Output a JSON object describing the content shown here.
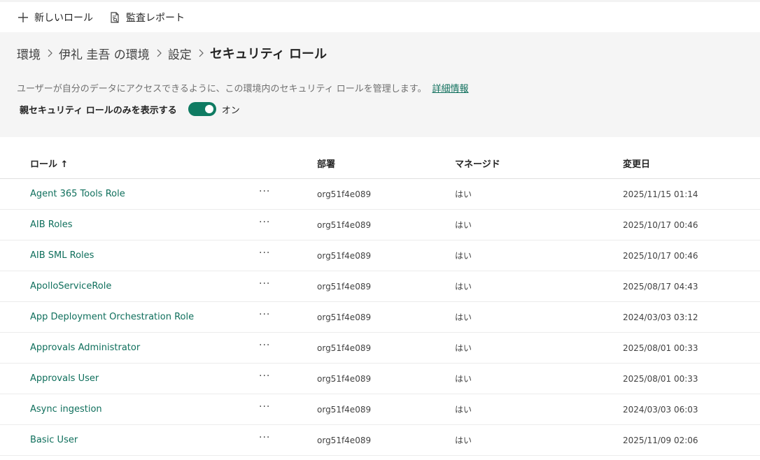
{
  "commandbar": {
    "new_role": "新しいロール",
    "audit_report": "監査レポート"
  },
  "breadcrumb": {
    "items": [
      "環境",
      "伊礼 圭吾 の環境",
      "設定"
    ],
    "current": "セキュリティ ロール"
  },
  "description": {
    "text": "ユーザーが自分のデータにアクセスできるように、この環境内のセキュリティ ロールを管理します。",
    "link": "詳細情報"
  },
  "toggle": {
    "label": "親セキュリティ ロールのみを表示する",
    "state": "オン",
    "on": true
  },
  "table": {
    "headers": {
      "name": "ロール ↑",
      "department": "部署",
      "managed": "マネージド",
      "modified": "変更日"
    },
    "more_label": "···",
    "rows": [
      {
        "name": "Agent 365 Tools Role",
        "department": "org51f4e089",
        "managed": "はい",
        "modified": "2025/11/15 01:14"
      },
      {
        "name": "AIB Roles",
        "department": "org51f4e089",
        "managed": "はい",
        "modified": "2025/10/17 00:46"
      },
      {
        "name": "AIB SML Roles",
        "department": "org51f4e089",
        "managed": "はい",
        "modified": "2025/10/17 00:46"
      },
      {
        "name": "ApolloServiceRole",
        "department": "org51f4e089",
        "managed": "はい",
        "modified": "2025/08/17 04:43"
      },
      {
        "name": "App Deployment Orchestration Role",
        "department": "org51f4e089",
        "managed": "はい",
        "modified": "2024/03/03 03:12"
      },
      {
        "name": "Approvals Administrator",
        "department": "org51f4e089",
        "managed": "はい",
        "modified": "2025/08/01 00:33"
      },
      {
        "name": "Approvals User",
        "department": "org51f4e089",
        "managed": "はい",
        "modified": "2025/08/01 00:33"
      },
      {
        "name": "Async ingestion",
        "department": "org51f4e089",
        "managed": "はい",
        "modified": "2024/03/03 06:03"
      },
      {
        "name": "Basic User",
        "department": "org51f4e089",
        "managed": "はい",
        "modified": "2025/11/09 02:06"
      }
    ]
  },
  "colors": {
    "accent": "#0f7b62",
    "link": "#0f6f5c"
  }
}
